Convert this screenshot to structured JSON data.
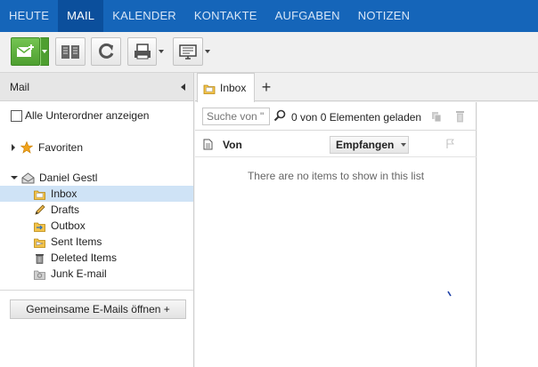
{
  "nav": {
    "tabs": [
      {
        "label": "HEUTE"
      },
      {
        "label": "MAIL"
      },
      {
        "label": "KALENDER"
      },
      {
        "label": "KONTAKTE"
      },
      {
        "label": "AUFGABEN"
      },
      {
        "label": "NOTIZEN"
      }
    ],
    "active": "MAIL"
  },
  "toolbar": {
    "buttons": [
      "new-mail-icon",
      "address-book-icon",
      "refresh-icon",
      "print-icon",
      "view-icon"
    ]
  },
  "sidebar": {
    "title": "Mail",
    "show_subfolders_label": "Alle Unterordner anzeigen",
    "favorites_label": "Favoriten",
    "account_label": "Daniel Gestl",
    "folders": [
      {
        "label": "Inbox",
        "icon": "inbox-folder-icon"
      },
      {
        "label": "Drafts",
        "icon": "pencil-icon"
      },
      {
        "label": "Outbox",
        "icon": "outbox-icon"
      },
      {
        "label": "Sent Items",
        "icon": "sent-items-icon"
      },
      {
        "label": "Deleted Items",
        "icon": "trash-icon"
      },
      {
        "label": "Junk E-mail",
        "icon": "junk-icon"
      }
    ],
    "shared_button_label": "Gemeinsame E-Mails öffnen +"
  },
  "tabs": {
    "inbox_label": "Inbox"
  },
  "list": {
    "search_placeholder": "Suche von \"",
    "count_text": "0 von 0 Elementen geladen",
    "column_from": "Von",
    "sort_label": "Empfangen",
    "empty_text": "There are no items to show in this list"
  },
  "colors": {
    "nav_bg": "#1565b9",
    "nav_active": "#0b4f9c",
    "new_mail_green": "#5db13b",
    "selected_row": "#cfe3f6"
  }
}
